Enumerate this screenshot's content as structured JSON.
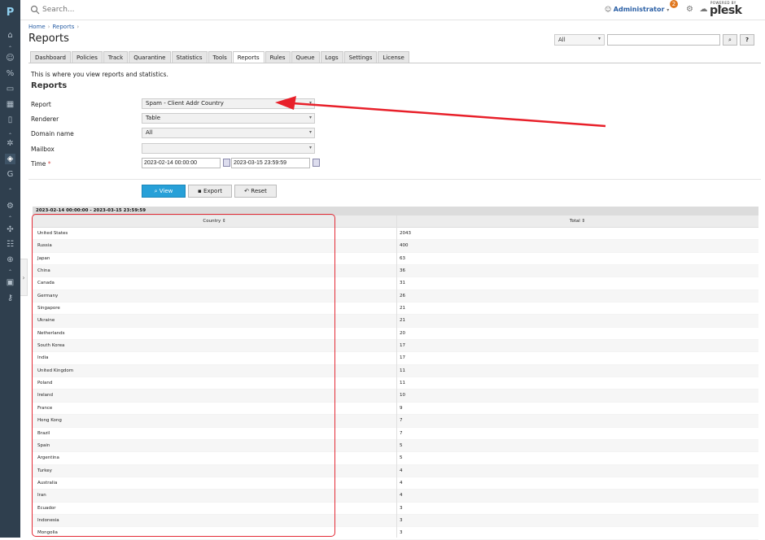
{
  "search": {
    "placeholder": "Search..."
  },
  "topbar": {
    "user": "Administrator",
    "notification_count": "2",
    "powered_by": "POWERED BY",
    "brand": "plesk"
  },
  "breadcrumb": [
    "Home",
    "Reports"
  ],
  "page_title": "Reports",
  "filter": {
    "select_value": "All",
    "search_label": "⌕",
    "help_label": "?"
  },
  "tabs": [
    {
      "label": "Dashboard"
    },
    {
      "label": "Policies"
    },
    {
      "label": "Track"
    },
    {
      "label": "Quarantine"
    },
    {
      "label": "Statistics"
    },
    {
      "label": "Tools"
    },
    {
      "label": "Reports",
      "active": true
    },
    {
      "label": "Rules"
    },
    {
      "label": "Queue"
    },
    {
      "label": "Logs"
    },
    {
      "label": "Settings"
    },
    {
      "label": "License"
    }
  ],
  "description": "This is where you view reports and statistics.",
  "section_title": "Reports",
  "form": {
    "report_label": "Report",
    "report_value": "Spam - Client Addr Country",
    "renderer_label": "Renderer",
    "renderer_value": "Table",
    "domain_label": "Domain name",
    "domain_value": "All",
    "mailbox_label": "Mailbox",
    "mailbox_value": "",
    "time_label": "Time",
    "time_required": "*",
    "time_from": "2023-02-14 00:00:00",
    "time_to": "2023-03-15 23:59:59"
  },
  "buttons": {
    "view": "View",
    "export": "Export",
    "reset": "Reset"
  },
  "table": {
    "range": "2023-02-14 00:00:00 - 2023-03-15 23:59:59",
    "col_country": "Country ⇕",
    "col_total": "Total ⇕",
    "rows": [
      [
        "United States",
        "2043"
      ],
      [
        "Russia",
        "400"
      ],
      [
        "Japan",
        "63"
      ],
      [
        "China",
        "36"
      ],
      [
        "Canada",
        "31"
      ],
      [
        "Germany",
        "26"
      ],
      [
        "Singapore",
        "21"
      ],
      [
        "Ukraine",
        "21"
      ],
      [
        "Netherlands",
        "20"
      ],
      [
        "South Korea",
        "17"
      ],
      [
        "India",
        "17"
      ],
      [
        "United Kingdom",
        "11"
      ],
      [
        "Poland",
        "11"
      ],
      [
        "Ireland",
        "10"
      ],
      [
        "France",
        "9"
      ],
      [
        "Hong Kong",
        "7"
      ],
      [
        "Brazil",
        "7"
      ],
      [
        "Spain",
        "5"
      ],
      [
        "Argentina",
        "5"
      ],
      [
        "Turkey",
        "4"
      ],
      [
        "Australia",
        "4"
      ],
      [
        "Iran",
        "4"
      ],
      [
        "Ecuador",
        "3"
      ],
      [
        "Indonesia",
        "3"
      ],
      [
        "Mongolia",
        "3"
      ]
    ]
  },
  "colors": {
    "sidebar": "#2f3f4e",
    "primary": "#27a0d8",
    "highlight": "#e32b36",
    "link": "#2a5fa5"
  }
}
